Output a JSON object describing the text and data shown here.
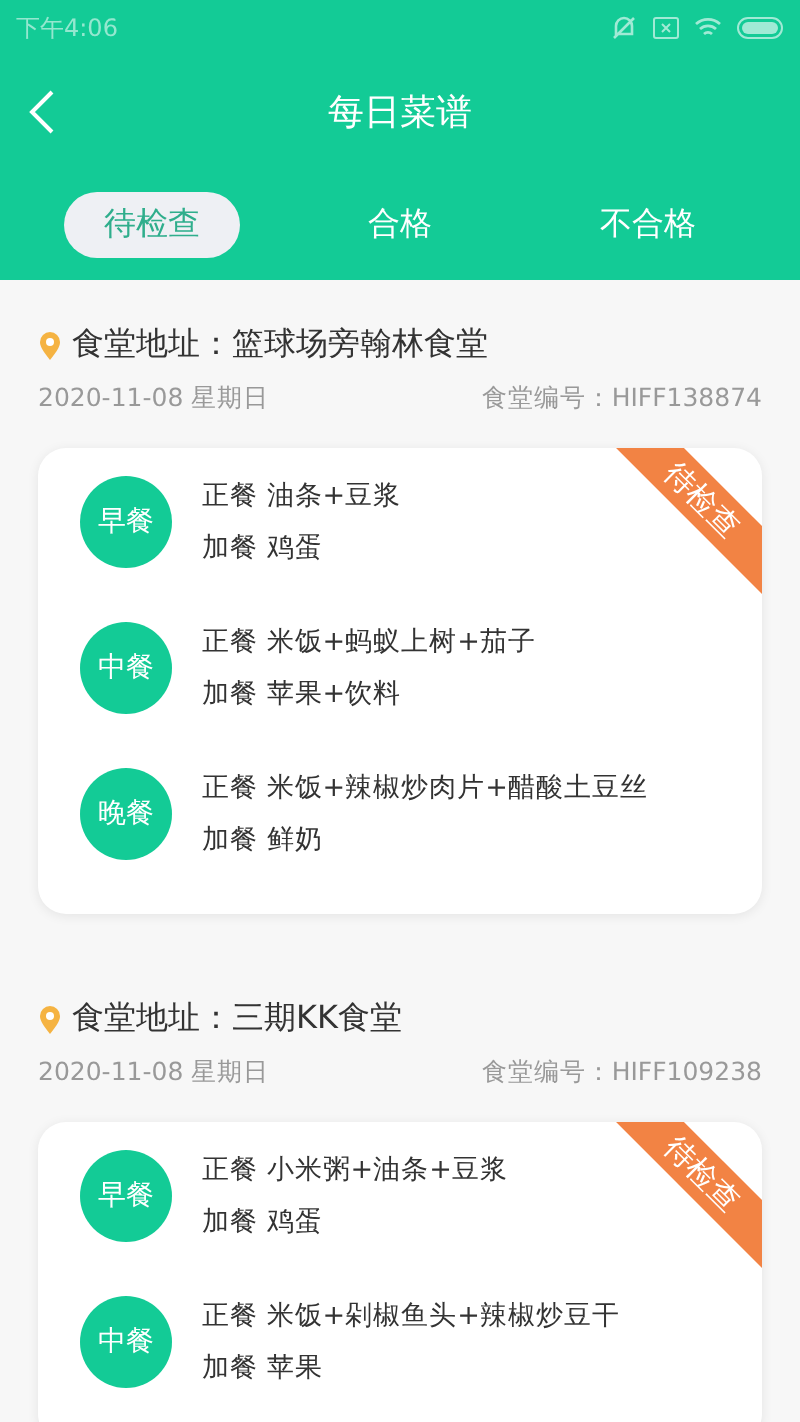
{
  "status_bar": {
    "time": "下午4:06"
  },
  "header": {
    "title": "每日菜谱"
  },
  "tabs": [
    {
      "label": "待检查",
      "selected": true
    },
    {
      "label": "合格",
      "selected": false
    },
    {
      "label": "不合格",
      "selected": false
    }
  ],
  "canteens": [
    {
      "address": "食堂地址：篮球场旁翰林食堂",
      "date": "2020-11-08 星期日",
      "code": "食堂编号：HIFF138874",
      "status": "待检查",
      "meals": [
        {
          "label": "早餐",
          "main": "正餐 油条+豆浆",
          "extra": "加餐 鸡蛋"
        },
        {
          "label": "中餐",
          "main": "正餐 米饭+蚂蚁上树+茄子",
          "extra": "加餐 苹果+饮料"
        },
        {
          "label": "晚餐",
          "main": "正餐 米饭+辣椒炒肉片+醋酸土豆丝",
          "extra": "加餐 鲜奶"
        }
      ]
    },
    {
      "address": "食堂地址：三期KK食堂",
      "date": "2020-11-08 星期日",
      "code": "食堂编号：HIFF109238",
      "status": "待检查",
      "meals": [
        {
          "label": "早餐",
          "main": "正餐 小米粥+油条+豆浆",
          "extra": "加餐 鸡蛋"
        },
        {
          "label": "中餐",
          "main": "正餐 米饭+剁椒鱼头+辣椒炒豆干",
          "extra": "加餐 苹果"
        }
      ]
    }
  ]
}
